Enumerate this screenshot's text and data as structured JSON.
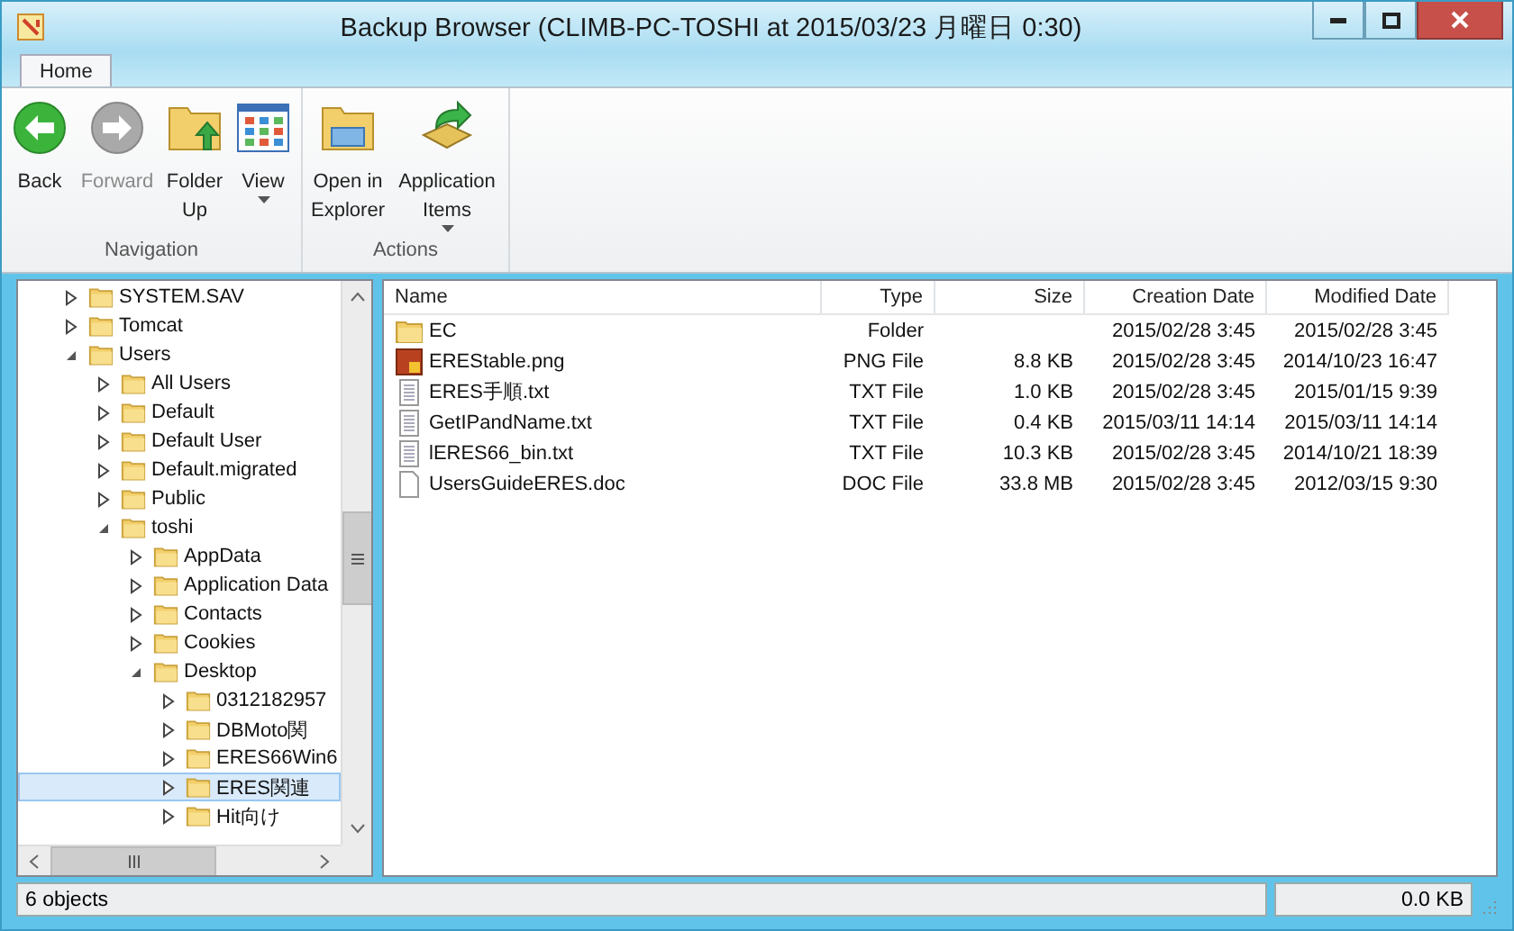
{
  "window": {
    "title": "Backup Browser (CLIMB-PC-TOSHI at 2015/03/23 月曜日 0:30)"
  },
  "tabs": [
    {
      "label": "Home",
      "selected": true
    }
  ],
  "ribbon": {
    "groups": [
      {
        "label": "Navigation",
        "buttons": [
          {
            "kind": "back",
            "label": "Back",
            "disabled": false,
            "dropdown": false
          },
          {
            "kind": "forward",
            "label": "Forward",
            "disabled": true,
            "dropdown": false
          },
          {
            "kind": "folder-up",
            "label": "Folder Up",
            "disabled": false,
            "dropdown": false
          },
          {
            "kind": "view",
            "label": "View",
            "disabled": false,
            "dropdown": true
          }
        ]
      },
      {
        "label": "Actions",
        "buttons": [
          {
            "kind": "explorer",
            "label": "Open in Explorer",
            "disabled": false,
            "dropdown": false
          },
          {
            "kind": "app-items",
            "label": "Application Items",
            "disabled": false,
            "dropdown": true
          }
        ]
      }
    ]
  },
  "tree": [
    {
      "label": "SYSTEM.SAV",
      "expanded": false,
      "selected": false
    },
    {
      "label": "Tomcat",
      "expanded": false,
      "selected": false
    },
    {
      "label": "Users",
      "expanded": true,
      "selected": false,
      "children": [
        {
          "label": "All Users",
          "expanded": false,
          "selected": false
        },
        {
          "label": "Default",
          "expanded": false,
          "selected": false
        },
        {
          "label": "Default User",
          "expanded": false,
          "selected": false
        },
        {
          "label": "Default.migrated",
          "expanded": false,
          "selected": false
        },
        {
          "label": "Public",
          "expanded": false,
          "selected": false
        },
        {
          "label": "toshi",
          "expanded": true,
          "selected": false,
          "children": [
            {
              "label": "AppData",
              "expanded": false,
              "selected": false
            },
            {
              "label": "Application Data",
              "expanded": false,
              "selected": false
            },
            {
              "label": "Contacts",
              "expanded": false,
              "selected": false
            },
            {
              "label": "Cookies",
              "expanded": false,
              "selected": false
            },
            {
              "label": "Desktop",
              "expanded": true,
              "selected": false,
              "children": [
                {
                  "label": "0312182957",
                  "expanded": false,
                  "selected": false
                },
                {
                  "label": "DBMoto関",
                  "expanded": false,
                  "selected": false
                },
                {
                  "label": "ERES66Win6",
                  "expanded": false,
                  "selected": false
                },
                {
                  "label": "ERES関連",
                  "expanded": false,
                  "selected": true
                },
                {
                  "label": "Hit向け",
                  "expanded": false,
                  "selected": false
                }
              ]
            }
          ]
        }
      ]
    }
  ],
  "table": {
    "columns": [
      "Name",
      "Type",
      "Size",
      "Creation Date",
      "Modified Date"
    ],
    "rows": [
      {
        "kind": "folder",
        "name": "EC",
        "type": "Folder",
        "size": "",
        "created": "2015/02/28 3:45",
        "modified": "2015/02/28 3:45"
      },
      {
        "kind": "image",
        "name": "EREStable.png",
        "type": "PNG File",
        "size": "8.8 KB",
        "created": "2015/02/28 3:45",
        "modified": "2014/10/23 16:47"
      },
      {
        "kind": "text",
        "name": "ERES手順.txt",
        "type": "TXT File",
        "size": "1.0 KB",
        "created": "2015/02/28 3:45",
        "modified": "2015/01/15 9:39"
      },
      {
        "kind": "text",
        "name": "GetIPandName.txt",
        "type": "TXT File",
        "size": "0.4 KB",
        "created": "2015/03/11 14:14",
        "modified": "2015/03/11 14:14"
      },
      {
        "kind": "text",
        "name": "lERES66_bin.txt",
        "type": "TXT File",
        "size": "10.3 KB",
        "created": "2015/02/28 3:45",
        "modified": "2014/10/21 18:39"
      },
      {
        "kind": "document",
        "name": "UsersGuideERES.doc",
        "type": "DOC File",
        "size": "33.8 MB",
        "created": "2015/02/28 3:45",
        "modified": "2012/03/15 9:30"
      }
    ]
  },
  "status_bar": {
    "count": "6 objects",
    "size": "0.0 KB"
  }
}
